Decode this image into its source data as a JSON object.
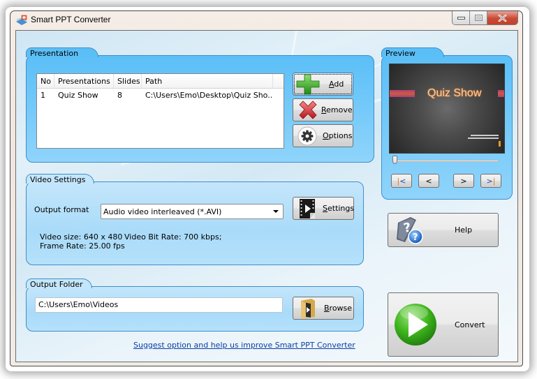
{
  "window": {
    "title": "Smart PPT Converter",
    "controls": {
      "minimize": "minimize",
      "maximize": "maximize",
      "close": "close"
    }
  },
  "presentation": {
    "group_label": "Presentation",
    "columns": [
      "No",
      "Presentations",
      "Slides",
      "Path"
    ],
    "rows": [
      {
        "no": "1",
        "name": "Quiz Show",
        "slides": "8",
        "path": "C:\\Users\\Emo\\Desktop\\Quiz Sho..."
      }
    ],
    "buttons": {
      "add": {
        "label": "Add",
        "mnemonic": "A",
        "icon": "plus-icon",
        "color": "#3aa52a"
      },
      "remove": {
        "label": "Remove",
        "mnemonic": "R",
        "icon": "x-icon",
        "color": "#d0232a"
      },
      "options": {
        "label": "Options",
        "mnemonic": "O",
        "icon": "gear-icon"
      }
    }
  },
  "preview": {
    "group_label": "Preview",
    "slide_title": "Quiz Show",
    "slider_position": 0,
    "nav": {
      "first": "|<",
      "prev": "<",
      "next": ">",
      "last": ">|"
    }
  },
  "video_settings": {
    "group_label": "Video Settings",
    "output_format_label": "Output format",
    "output_format_value": "Audio video interleaved (*.AVI)",
    "settings_button": "Settings",
    "video_size": "Video size: 640 x 480",
    "bit_rate": "Video Bit Rate: 700 kbps;",
    "frame_rate": "Frame Rate: 25.00 fps"
  },
  "output_folder": {
    "group_label": "Output Folder",
    "path": "C:\\Users\\Emo\\Videos",
    "browse_button": "Browse"
  },
  "help_button": "Help",
  "convert_button": "Convert",
  "suggest_link": "Suggest option and help us improve Smart PPT Converter",
  "colors": {
    "group_blue": "#5bbff7",
    "group_light": "#c4e6fb",
    "link": "#0a3fa3",
    "convert_green": "#3db41c"
  }
}
